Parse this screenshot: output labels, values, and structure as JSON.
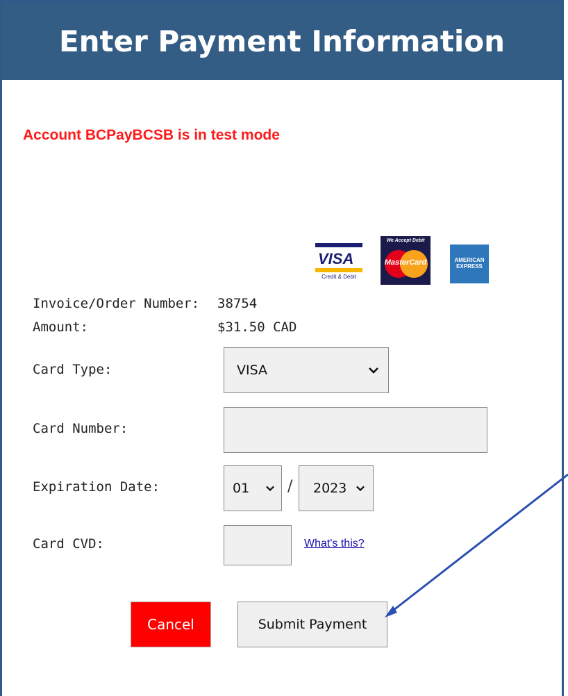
{
  "header": {
    "title": "Enter Payment Information"
  },
  "notice": {
    "text": "Account BCPayBCSB is in test mode"
  },
  "logos": {
    "visa": {
      "word": "VISA",
      "sub": "Credit & Debit",
      "icon": "visa-logo"
    },
    "mastercard": {
      "caption": "We Accept Debit",
      "name": "MasterCard",
      "icon": "mastercard-logo"
    },
    "amex": {
      "text": "AMERICAN EXPRESS",
      "icon": "amex-logo"
    }
  },
  "form": {
    "invoice": {
      "label": "Invoice/Order Number:",
      "value": "38754"
    },
    "amount": {
      "label": "Amount:",
      "value": "$31.50 CAD"
    },
    "card_type": {
      "label": "Card Type:",
      "selected": "VISA"
    },
    "card_number": {
      "label": "Card Number:",
      "value": ""
    },
    "expiration": {
      "label": "Expiration Date:",
      "month": "01",
      "separator": "/",
      "year": "2023"
    },
    "cvd": {
      "label": "Card CVD:",
      "value": "",
      "help_link": "What's this?"
    }
  },
  "buttons": {
    "cancel": "Cancel",
    "submit": "Submit Payment"
  },
  "colors": {
    "header_bg": "#345d86",
    "notice": "#ff1a1a",
    "cancel_bg": "#ff0000",
    "arrow": "#2a4fb0"
  }
}
